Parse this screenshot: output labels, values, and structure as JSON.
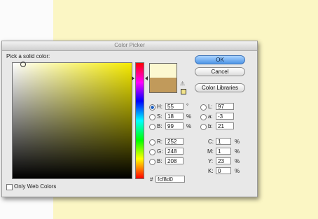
{
  "dialog": {
    "title": "Color Picker",
    "pick_label": "Pick a solid color:"
  },
  "buttons": {
    "ok": "OK",
    "cancel": "Cancel",
    "libraries": "Color Libraries"
  },
  "hsb": {
    "h": {
      "label": "H:",
      "value": "55",
      "unit": "°"
    },
    "s": {
      "label": "S:",
      "value": "18",
      "unit": "%"
    },
    "b": {
      "label": "B:",
      "value": "99",
      "unit": "%"
    }
  },
  "rgb": {
    "r": {
      "label": "R:",
      "value": "252"
    },
    "g": {
      "label": "G:",
      "value": "248"
    },
    "b": {
      "label": "B:",
      "value": "208"
    }
  },
  "lab": {
    "l": {
      "label": "L:",
      "value": "97"
    },
    "a": {
      "label": "a:",
      "value": "-3"
    },
    "b": {
      "label": "b:",
      "value": "21"
    }
  },
  "cmyk": {
    "c": {
      "label": "C:",
      "value": "1",
      "unit": "%"
    },
    "m": {
      "label": "M:",
      "value": "1",
      "unit": "%"
    },
    "y": {
      "label": "Y:",
      "value": "23",
      "unit": "%"
    },
    "k": {
      "label": "K:",
      "value": "0",
      "unit": "%"
    }
  },
  "hex": {
    "label": "#",
    "value": "fcf8d0"
  },
  "only_web_colors": "Only Web Colors",
  "colors": {
    "new_color": "#fcf8d0",
    "current_color": "#c19a5b",
    "document_bg": "#fbf6c4",
    "ok_accent": "#4e95e6"
  },
  "icons": [
    "warning-icon",
    "cube-icon"
  ]
}
